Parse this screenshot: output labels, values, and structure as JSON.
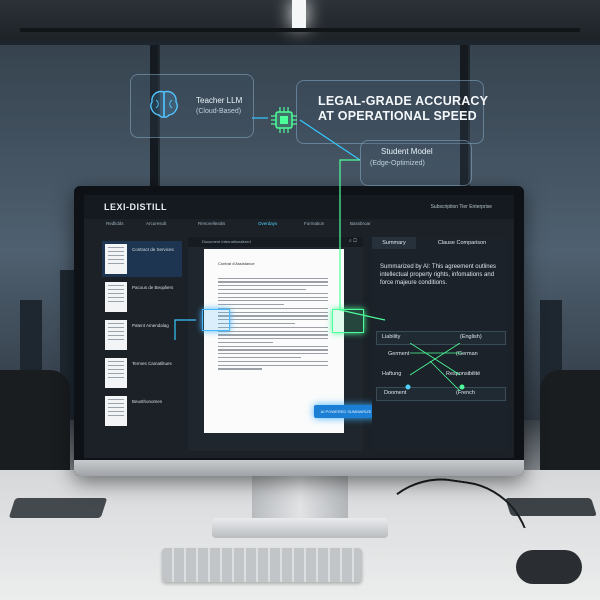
{
  "overlay": {
    "teacher_title": "Teacher LLM",
    "teacher_sub": "(Cloud-Based)",
    "headline_line1": "LEGAL-GRADE ACCURACY",
    "headline_line2": "AT OPERATIONAL SPEED",
    "student_title": "Student Model",
    "student_sub": "(Edge-Optimized)"
  },
  "app": {
    "logo": "LEXI-DISTILL",
    "header_right": "Subscription Tier   Enterprise",
    "tabs": [
      "Redlidds",
      "Arcuresult",
      "Renorelleaitis",
      "Overdays",
      "Formation",
      "Bassbroar"
    ],
    "active_tab_index": 3
  },
  "documents": [
    {
      "label": "Contract de Services"
    },
    {
      "label": "Pacous de Beopliers"
    },
    {
      "label": "Patent Amendalag"
    },
    {
      "label": "Termes Camatiltues"
    },
    {
      "label": "Beusthonomes"
    }
  ],
  "viewer": {
    "title": "Document Internationalized",
    "icons": "⌕ ▢",
    "page_title": "Contrat d'Assistance",
    "ai_button": "AI POWERED SUMMARIZE"
  },
  "right_panel": {
    "tab_summary": "Summary",
    "tab_compare": "Clause Comparison",
    "summary": "Summarized by AI: This agreement outlines intellectual property rights, infomations and force majeure conditions.",
    "terms": {
      "liability": "Liability",
      "english": "(English)",
      "german_left": "Germent",
      "german_right": "(German",
      "haftung": "Haftung",
      "responsibilite": "Responsibilité",
      "document": "Dooment",
      "french": "(French"
    }
  },
  "colors": {
    "accent_blue": "#4fd0ff",
    "accent_green": "#4dff9a"
  }
}
